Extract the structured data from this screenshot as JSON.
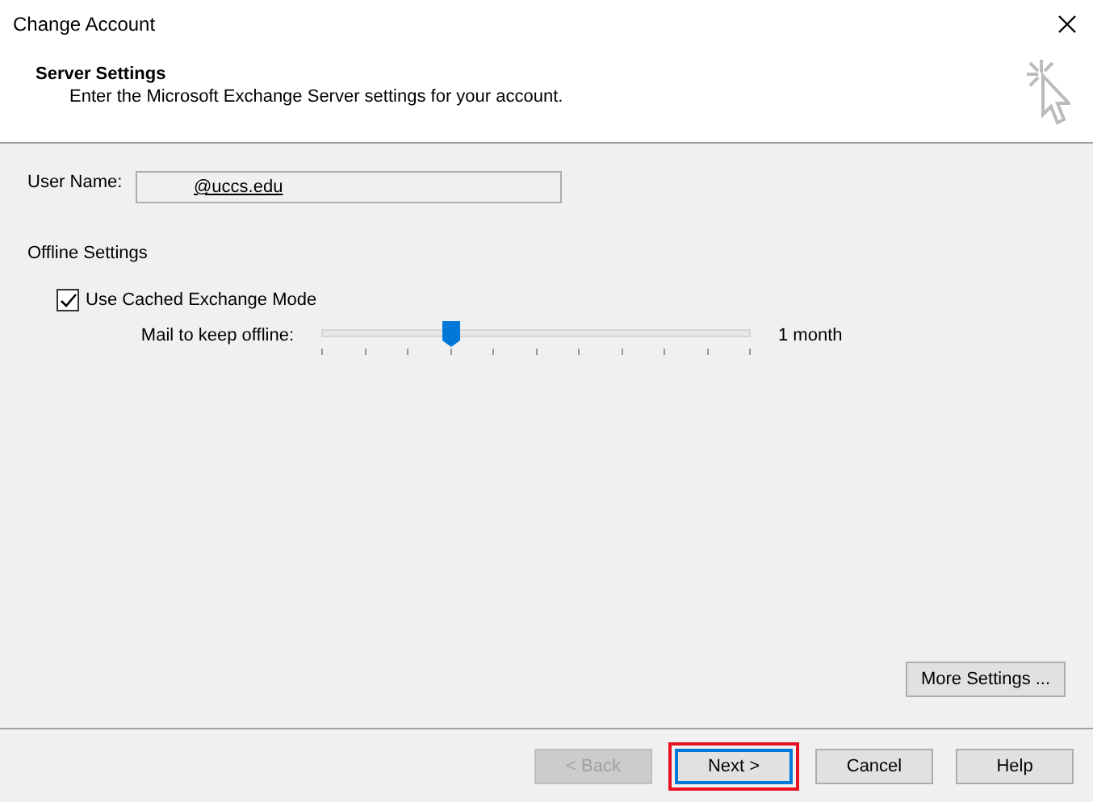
{
  "window": {
    "title": "Change Account"
  },
  "header": {
    "title": "Server Settings",
    "subtitle": "Enter the Microsoft Exchange Server settings for your account."
  },
  "user_name": {
    "label": "User Name:",
    "value": "@uccs.edu"
  },
  "offline": {
    "heading": "Offline Settings",
    "cached_mode": {
      "label": "Use Cached Exchange Mode",
      "checked": true
    },
    "slider": {
      "label": "Mail to keep offline:",
      "level": 0.3,
      "reading": "1 month"
    }
  },
  "more_settings": "More Settings ...",
  "buttons": [
    {
      "label": "< Back",
      "disabled": true,
      "default": false,
      "highlighted": false
    },
    {
      "label": "Next >",
      "disabled": false,
      "default": true,
      "highlighted": true
    },
    {
      "label": "Cancel",
      "disabled": false,
      "default": false,
      "highlighted": false
    },
    {
      "label": "Help",
      "disabled": false,
      "default": false,
      "highlighted": false
    }
  ]
}
